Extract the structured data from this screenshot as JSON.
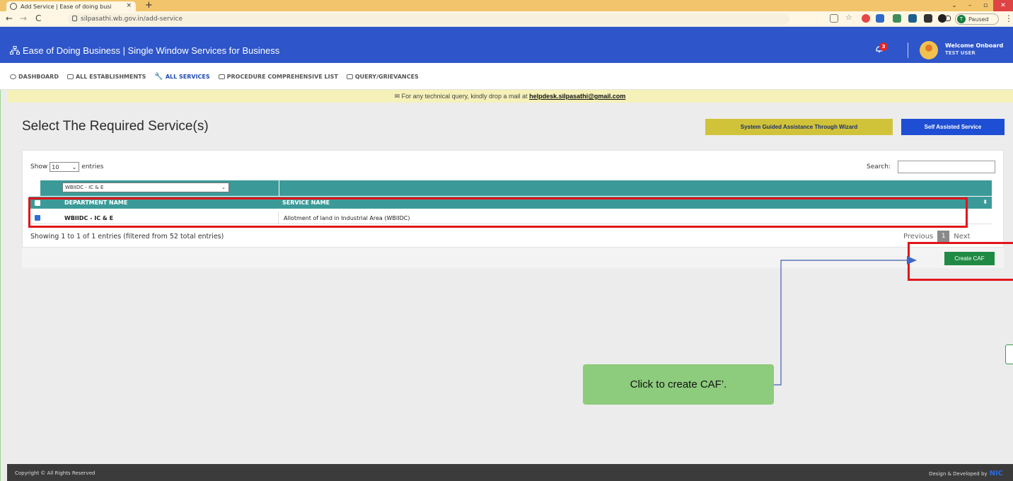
{
  "browser": {
    "tab_title": "Add Service | Ease of doing busi",
    "tab_close": "×",
    "new_tab": "+",
    "url": "silpasathi.wb.gov.in/add-service",
    "profile_initial": "T",
    "profile_status": "Paused",
    "back": "←",
    "forward": "→",
    "reload": "C",
    "menu": "⋮",
    "window_controls": [
      "⌄",
      "–",
      "▫",
      "✕"
    ]
  },
  "header": {
    "title": "Ease of Doing Business | Single Window Services for Business",
    "notification_count": "3",
    "welcome": "Welcome Onboard",
    "user": "TEST USER"
  },
  "menu": {
    "items": [
      {
        "label": "DASHBOARD",
        "active": false
      },
      {
        "label": "ALL ESTABLISHMENTS",
        "active": false
      },
      {
        "label": "ALL SERVICES",
        "active": true
      },
      {
        "label": "PROCEDURE COMPREHENSIVE LIST",
        "active": false
      },
      {
        "label": "QUERY/GRIEVANCES",
        "active": false
      }
    ]
  },
  "notice": {
    "text": "For any technical query, kindly drop a mail at",
    "email": "helpdesk.silpasathi@gmail.com"
  },
  "page": {
    "title": "Select The Required Service(s)",
    "wizard_button": "System Guided Assistance Through Wizard",
    "self_button": "Self Assisted Service"
  },
  "table": {
    "show_label": "Show",
    "entries_label": "entries",
    "page_size": "10",
    "search_label": "Search:",
    "search_value": "",
    "filter_value": "WBIIDC - IC & E",
    "columns": [
      "DEPARTMENT NAME",
      "SERVICE NAME"
    ],
    "rows": [
      {
        "checked": true,
        "department": "WBIIDC - IC & E",
        "service": "Allotment of land in Industrial Area (WBIIDC)"
      }
    ],
    "info": "Showing 1 to 1 of 1 entries (filtered from 52 total entries)",
    "prev": "Previous",
    "page": "1",
    "next": "Next",
    "create_button": "Create CAF"
  },
  "callout": {
    "text": "Click to create CAF’."
  },
  "footer": {
    "left": "Copyright © All Rights Reserved",
    "right": "Design & Developed by",
    "logo": "NIC"
  },
  "colors": {
    "header_blue": "#2e55c9",
    "table_teal": "#3b9a98",
    "highlight_red": "#e0151b",
    "callout_green": "#8dcb7d",
    "create_green": "#1f8a44"
  }
}
